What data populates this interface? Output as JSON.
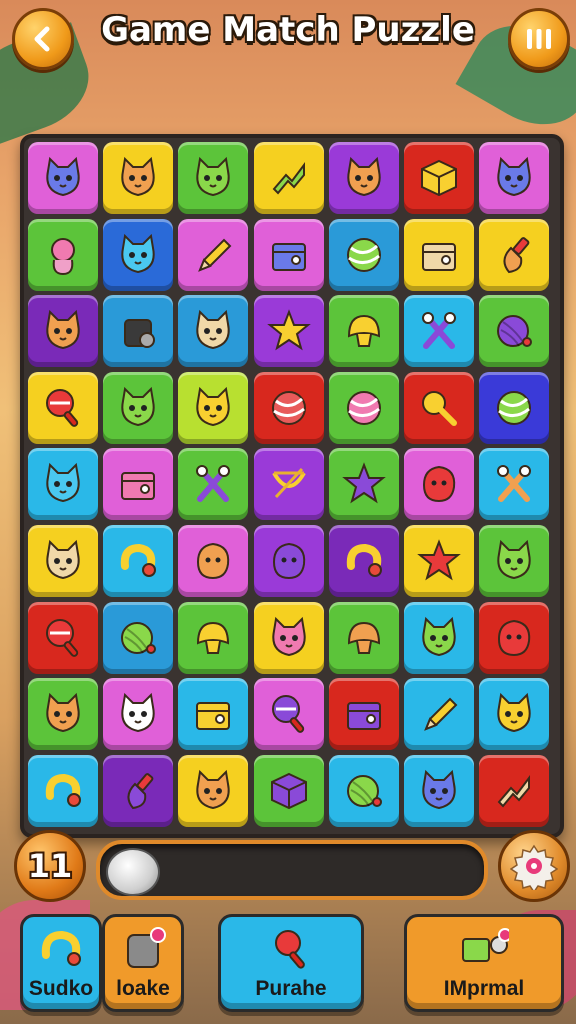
{
  "header": {
    "title": "Game Match Puzzle",
    "back_icon": "chevron-left-icon",
    "menu_icon": "pause-bars-icon"
  },
  "board": {
    "rows": 9,
    "cols": 7,
    "tiles": [
      [
        {
          "color": "#e060d8",
          "icon": "cat-blue"
        },
        {
          "color": "#f5d020",
          "icon": "cat-orange"
        },
        {
          "color": "#5cc43a",
          "icon": "cat-green"
        },
        {
          "color": "#f5d020",
          "icon": "arrow-green"
        },
        {
          "color": "#9a3ad8",
          "icon": "cat-orange"
        },
        {
          "color": "#d8281e",
          "icon": "cube-yellow"
        },
        {
          "color": "#e060d8",
          "icon": "cat-blue"
        }
      ],
      [
        {
          "color": "#5cc43a",
          "icon": "doll-pink"
        },
        {
          "color": "#2a6ad8",
          "icon": "cat-cyan"
        },
        {
          "color": "#e060d8",
          "icon": "pencil-yellow"
        },
        {
          "color": "#e060d8",
          "icon": "box-blue"
        },
        {
          "color": "#2a9ad8",
          "icon": "ball-green"
        },
        {
          "color": "#f5d020",
          "icon": "box-beige"
        },
        {
          "color": "#f5d020",
          "icon": "brush-orange"
        }
      ],
      [
        {
          "color": "#7a2ab8",
          "icon": "cat-orange"
        },
        {
          "color": "#2a9ad8",
          "icon": "bag-dark"
        },
        {
          "color": "#2a9ad8",
          "icon": "cat-beige"
        },
        {
          "color": "#9a3ad8",
          "icon": "star-yellow"
        },
        {
          "color": "#5cc43a",
          "icon": "shell-yellow"
        },
        {
          "color": "#2ab8e8",
          "icon": "scissors-purple"
        },
        {
          "color": "#5cc43a",
          "icon": "yarn-purple"
        }
      ],
      [
        {
          "color": "#f5d020",
          "icon": "rattle-red"
        },
        {
          "color": "#5cc43a",
          "icon": "cat-green"
        },
        {
          "color": "#b8e030",
          "icon": "cat-yellow"
        },
        {
          "color": "#d8281e",
          "icon": "ball-striped"
        },
        {
          "color": "#5cc43a",
          "icon": "ball-pink"
        },
        {
          "color": "#d8281e",
          "icon": "key-yellow"
        },
        {
          "color": "#3a3ad8",
          "icon": "ball-green"
        }
      ],
      [
        {
          "color": "#2ab8e8",
          "icon": "cat-cyan"
        },
        {
          "color": "#e060d8",
          "icon": "box-pink"
        },
        {
          "color": "#5cc43a",
          "icon": "scissors-purple"
        },
        {
          "color": "#9a3ad8",
          "icon": "bow-yellow"
        },
        {
          "color": "#5cc43a",
          "icon": "star-purple"
        },
        {
          "color": "#e060d8",
          "icon": "blob-red"
        },
        {
          "color": "#2ab8e8",
          "icon": "scissors-orange"
        }
      ],
      [
        {
          "color": "#f5d020",
          "icon": "cat-beige"
        },
        {
          "color": "#2ab8e8",
          "icon": "hook-yellow"
        },
        {
          "color": "#e060d8",
          "icon": "blob-orange"
        },
        {
          "color": "#9a3ad8",
          "icon": "blob-purple"
        },
        {
          "color": "#7a2ab8",
          "icon": "hook-yellow"
        },
        {
          "color": "#f5d020",
          "icon": "star-red"
        },
        {
          "color": "#5cc43a",
          "icon": "cat-green"
        }
      ],
      [
        {
          "color": "#d8281e",
          "icon": "rattle-red"
        },
        {
          "color": "#2a9ad8",
          "icon": "yarn-green"
        },
        {
          "color": "#5cc43a",
          "icon": "shell-yellow"
        },
        {
          "color": "#f5d020",
          "icon": "cat-pink"
        },
        {
          "color": "#5cc43a",
          "icon": "shell-orange"
        },
        {
          "color": "#2ab8e8",
          "icon": "cat-green"
        },
        {
          "color": "#d8281e",
          "icon": "blob-red"
        }
      ],
      [
        {
          "color": "#5cc43a",
          "icon": "cat-orange"
        },
        {
          "color": "#e060d8",
          "icon": "cat-white"
        },
        {
          "color": "#2ab8e8",
          "icon": "box-yellow"
        },
        {
          "color": "#e060d8",
          "icon": "rattle-purple"
        },
        {
          "color": "#d8281e",
          "icon": "box-purple"
        },
        {
          "color": "#2ab8e8",
          "icon": "pencil-yellow"
        },
        {
          "color": "#2ab8e8",
          "icon": "cat-yellow"
        }
      ],
      [
        {
          "color": "#2ab8e8",
          "icon": "hook-yellow"
        },
        {
          "color": "#7a2ab8",
          "icon": "brush-purple"
        },
        {
          "color": "#f5d020",
          "icon": "cat-orange"
        },
        {
          "color": "#5cc43a",
          "icon": "cube-purple"
        },
        {
          "color": "#2ab8e8",
          "icon": "yarn-green"
        },
        {
          "color": "#2ab8e8",
          "icon": "cat-blue"
        },
        {
          "color": "#d8281e",
          "icon": "arrow-beige"
        }
      ]
    ]
  },
  "status": {
    "moves_count": "11",
    "progress_fraction": 0.0,
    "settings_icon": "gear-icon"
  },
  "actions": [
    {
      "label": "Sudko",
      "color": "#2ab8e8",
      "icon": "hook-icon"
    },
    {
      "label": "loake",
      "color": "#f09a2a",
      "icon": "bag-icon"
    },
    {
      "label": "Purahe",
      "color": "#2ab8e8",
      "icon": "rattle-icon"
    },
    {
      "label": "IMprmal",
      "color": "#f09a2a",
      "icon": "box-icon"
    }
  ]
}
